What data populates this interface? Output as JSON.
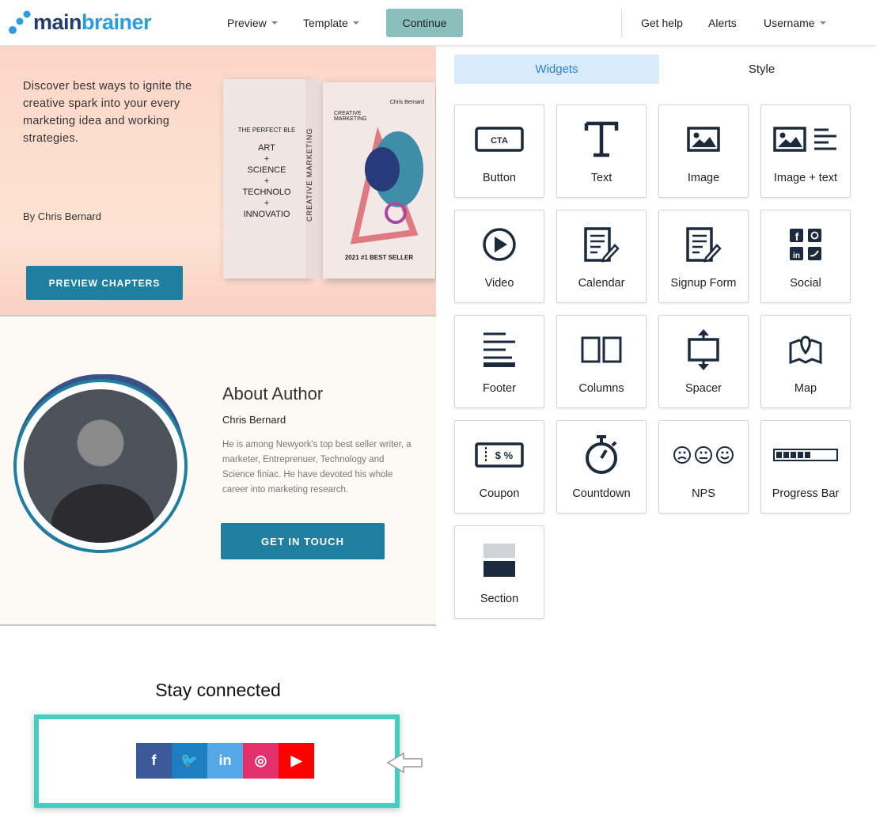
{
  "header": {
    "logo": {
      "part1": "main",
      "part2": "brainer"
    },
    "nav": [
      {
        "label": "Preview"
      },
      {
        "label": "Template"
      }
    ],
    "continue_label": "Continue",
    "right_nav": [
      {
        "label": "Get help"
      },
      {
        "label": "Alerts"
      },
      {
        "label": "Username"
      }
    ]
  },
  "hero": {
    "text": "Discover best ways to ignite the creative spark into your every marketing idea and working strategies.",
    "byline": "By Chris Bernard",
    "cta": "PREVIEW CHAPTERS",
    "book": {
      "cover_left": [
        "THE PERFECT BLE",
        "ART",
        "+",
        "SCIENCE",
        "+",
        "TECHNOLO",
        "+",
        "INNOVATIO"
      ],
      "spine": "CREATIVE MARKETING",
      "spine_author": "Chris Bernard",
      "front_title": "CREATIVE MARKETING",
      "front_author": "Chris Bernard",
      "front_badge": "2021 #1 BEST SELLER"
    }
  },
  "about": {
    "title": "About Author",
    "name": "Chris Bernard",
    "bio": "He is among Newyork's top best seller writer, a marketer, Entreprenuer, Technology and Science finiac. He have devoted his whole career into marketing research.",
    "cta": "GET IN TOUCH"
  },
  "stay": {
    "title": "Stay connected",
    "social": [
      {
        "icon": "facebook-icon",
        "glyph": "f",
        "color": "#3b5998"
      },
      {
        "icon": "twitter-icon",
        "glyph": "🐦",
        "color": "#1d7fc1"
      },
      {
        "icon": "linkedin-icon",
        "glyph": "in",
        "color": "#55a8e8"
      },
      {
        "icon": "instagram-icon",
        "glyph": "◎",
        "color": "#e1306c"
      },
      {
        "icon": "youtube-icon",
        "glyph": "▶",
        "color": "#ff0000"
      }
    ],
    "highlight_color": "#40cfc0"
  },
  "panel": {
    "tabs": [
      {
        "label": "Widgets",
        "active": true
      },
      {
        "label": "Style",
        "active": false
      }
    ],
    "widgets": [
      {
        "label": "Button",
        "icon": "cta-button-icon",
        "icon_text": "CTA"
      },
      {
        "label": "Text",
        "icon": "text-icon",
        "icon_text": "T"
      },
      {
        "label": "Image",
        "icon": "image-icon"
      },
      {
        "label": "Image + text",
        "icon": "image-text-icon"
      },
      {
        "label": "Video",
        "icon": "video-play-icon"
      },
      {
        "label": "Calendar",
        "icon": "calendar-icon"
      },
      {
        "label": "Signup Form",
        "icon": "signup-form-icon"
      },
      {
        "label": "Social",
        "icon": "social-icon"
      },
      {
        "label": "Footer",
        "icon": "footer-icon"
      },
      {
        "label": "Columns",
        "icon": "columns-icon"
      },
      {
        "label": "Spacer",
        "icon": "spacer-icon"
      },
      {
        "label": "Map",
        "icon": "map-icon"
      },
      {
        "label": "Coupon",
        "icon": "coupon-icon",
        "icon_text": "$ %"
      },
      {
        "label": "Countdown",
        "icon": "stopwatch-icon"
      },
      {
        "label": "NPS",
        "icon": "nps-faces-icon"
      },
      {
        "label": "Progress Bar",
        "icon": "progress-bar-icon"
      },
      {
        "label": "Section",
        "icon": "section-icon"
      }
    ]
  }
}
